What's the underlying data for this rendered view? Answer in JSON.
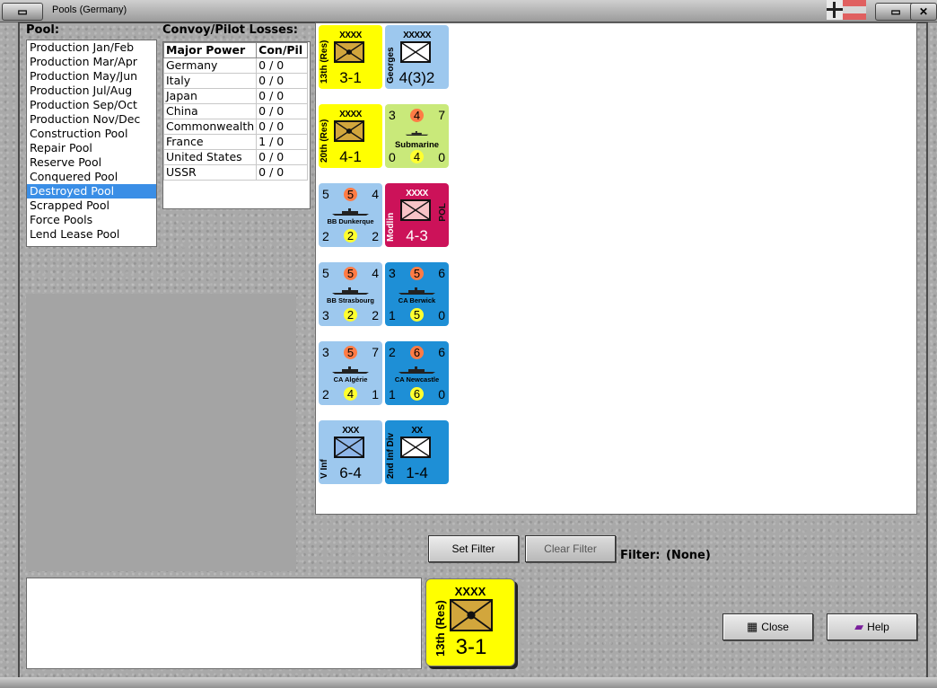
{
  "window": {
    "title": "Pools (Germany)"
  },
  "pool": {
    "label": "Pool:",
    "items": [
      "Production Jan/Feb",
      "Production Mar/Apr",
      "Production May/Jun",
      "Production Jul/Aug",
      "Production Sep/Oct",
      "Production Nov/Dec",
      "Construction Pool",
      "Repair Pool",
      "Reserve Pool",
      "Conquered Pool",
      "Destroyed Pool",
      "Scrapped Pool",
      "Force Pools",
      "Lend Lease Pool"
    ],
    "selected": "Destroyed Pool"
  },
  "losses": {
    "label": "Convoy/Pilot Losses:",
    "headers": [
      "Major Power",
      "Con/Pil"
    ],
    "rows": [
      [
        "Germany",
        "0 / 0"
      ],
      [
        "Italy",
        "0 / 0"
      ],
      [
        "Japan",
        "0 / 0"
      ],
      [
        "China",
        "0 / 0"
      ],
      [
        "Commonwealth",
        "0 / 0"
      ],
      [
        "France",
        "1 / 0"
      ],
      [
        "United States",
        "0 / 0"
      ],
      [
        "USSR",
        "0 / 0"
      ]
    ]
  },
  "counters": [
    {
      "id": "c1",
      "kind": "land",
      "color": "yellow",
      "name": "13th (Res)",
      "echelon": "XXXX",
      "strength": "3-1",
      "symbol": "tan"
    },
    {
      "id": "c2",
      "kind": "land",
      "color": "blue",
      "name": "Georges",
      "echelon": "XXXXX",
      "strength": "4(3)2",
      "symbol": "white"
    },
    {
      "id": "c3",
      "kind": "land",
      "color": "yellow",
      "name": "20th (Res)",
      "echelon": "XXXX",
      "strength": "4-1",
      "symbol": "tan"
    },
    {
      "id": "c4",
      "kind": "naval",
      "color": "green",
      "name": "Submarine",
      "tl": "3",
      "tc": "4",
      "tr": "7",
      "bl": "0",
      "bc": "4",
      "br": "0"
    },
    {
      "id": "c5",
      "kind": "naval",
      "color": "blue",
      "name": "BB Dunkerque",
      "tl": "5",
      "tc": "5",
      "tr": "4",
      "bl": "2",
      "bc": "2",
      "br": "2"
    },
    {
      "id": "c6",
      "kind": "land",
      "color": "red",
      "name": "Modlin",
      "side": "POL",
      "echelon": "XXXX",
      "strength": "4-3",
      "symbol": "pink"
    },
    {
      "id": "c7",
      "kind": "naval",
      "color": "blue",
      "name": "BB Strasbourg",
      "tl": "5",
      "tc": "5",
      "tr": "4",
      "bl": "3",
      "bc": "2",
      "br": "2"
    },
    {
      "id": "c8",
      "kind": "naval",
      "color": "blue2",
      "name": "CA Berwick",
      "tl": "3",
      "tc": "5",
      "tr": "6",
      "bl": "1",
      "bc": "5",
      "br": "0"
    },
    {
      "id": "c9",
      "kind": "naval",
      "color": "blue",
      "name": "CA Algérie",
      "tl": "3",
      "tc": "5",
      "tr": "7",
      "bl": "2",
      "bc": "4",
      "br": "1"
    },
    {
      "id": "c10",
      "kind": "naval",
      "color": "blue2",
      "name": "CA Newcastle",
      "tl": "2",
      "tc": "6",
      "tr": "6",
      "bl": "1",
      "bc": "6",
      "br": "0"
    },
    {
      "id": "c11",
      "kind": "land",
      "color": "blue",
      "name": "V Inf",
      "echelon": "XXX",
      "strength": "6-4",
      "symbol": "blue"
    },
    {
      "id": "c12",
      "kind": "land",
      "color": "blue2",
      "name": "2nd Inf Div",
      "echelon": "XX",
      "strength": "1-4",
      "symbol": "white"
    }
  ],
  "filter": {
    "set_label": "Set Filter",
    "clear_label": "Clear Filter",
    "label": "Filter:",
    "value": "(None)"
  },
  "selected_unit": {
    "name": "13th (Res)",
    "echelon": "XXXX",
    "strength": "3-1"
  },
  "buttons": {
    "close": "Close",
    "help": "Help"
  }
}
